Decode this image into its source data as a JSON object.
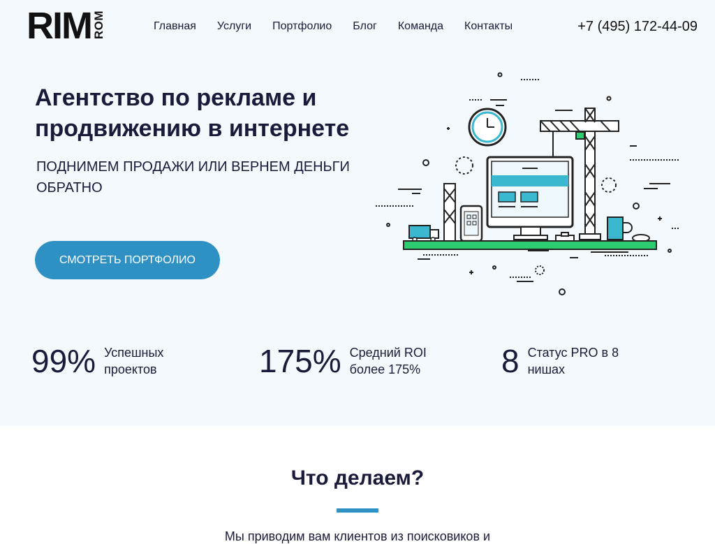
{
  "header": {
    "logo_main": "RIM",
    "logo_side": "ROM",
    "nav": [
      "Главная",
      "Услуги",
      "Портфолио",
      "Блог",
      "Команда",
      "Контакты"
    ],
    "phone": "+7 (495) 172-44-09"
  },
  "hero": {
    "title": "Агентство по рекламе и продвижению в интернете",
    "subtitle": "ПОДНИМЕМ ПРОДАЖИ ИЛИ ВЕРНЕМ ДЕНЬГИ ОБРАТНО",
    "cta_label": "СМОТРЕТЬ ПОРТФОЛИО"
  },
  "stats": [
    {
      "value": "99%",
      "label": "Успешных проектов"
    },
    {
      "value": "175%",
      "label": "Средний ROI более 175%"
    },
    {
      "value": "8",
      "label": "Статус PRO в 8 нишах"
    }
  ],
  "section": {
    "title": "Что делаем?",
    "text": "Мы приводим вам клиентов из поисковиков и"
  },
  "colors": {
    "accent": "#2f90c4",
    "hero_bg": "#f3f9fd",
    "text": "#1a1a3a",
    "illustration_green": "#2ecc71",
    "illustration_teal": "#3bb7d0"
  },
  "icons": [
    "crane-icon",
    "clock-icon",
    "monitor-icon",
    "phone-device-icon",
    "truck-icon",
    "mug-icon",
    "mouse-icon"
  ]
}
